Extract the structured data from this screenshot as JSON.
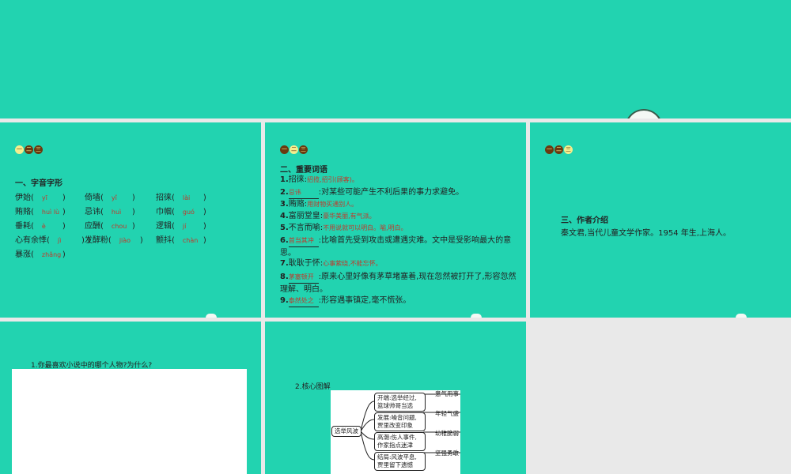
{
  "nav_dots": [
    "一",
    "二",
    "三"
  ],
  "slide2": {
    "heading": "一、字音字形",
    "rows": [
      [
        {
          "w": "伊始(",
          "p": "yī"
        },
        {
          "w": "倚墙(",
          "p": "yǐ"
        },
        {
          "w": "招徕(",
          "p": "lài"
        }
      ],
      [
        {
          "w": "贿赂(",
          "p": "huì lù"
        },
        {
          "w": "忌讳(",
          "p": "huì"
        },
        {
          "w": "巾帼(",
          "p": "guó"
        }
      ],
      [
        {
          "w": "垂耗(",
          "p": "è"
        },
        {
          "w": "应酬(",
          "p": "chou"
        },
        {
          "w": "逻辑(",
          "p": "jí"
        }
      ],
      [
        {
          "w": "心有余悸(",
          "p": "jì"
        },
        {
          "w": ")发酵粉(",
          "p": "jiào"
        },
        {
          "w": "颤抖(",
          "p": "chàn"
        }
      ],
      [
        {
          "w": "暴涨(",
          "p": "zhǎng"
        }
      ]
    ]
  },
  "slide3": {
    "heading": "二、重要词语",
    "items": [
      {
        "n": "1.",
        "term": "招徕",
        "ans": "招揽,招引(顾客)。",
        "def": ""
      },
      {
        "n": "2.",
        "term": "",
        "ans": "忌讳",
        "def": ":对某些可能产生不利后果的事力求避免。"
      },
      {
        "n": "3.",
        "term": "贿赂",
        "ans": "用财物买通别人。",
        "def": ""
      },
      {
        "n": "4.",
        "term": "富丽堂皇",
        "ans": "豪华美丽,有气派。",
        "def": ""
      },
      {
        "n": "5.",
        "term": "不言而喻",
        "ans": "不用说就可以明白。喻,明白。",
        "def": ""
      },
      {
        "n": "6.",
        "term": "",
        "ans": "首当其冲",
        "def": ":比喻首先受到攻击或遭遇灾难。文中是受影响最大的意思。"
      },
      {
        "n": "7.",
        "term": "耿耿于怀",
        "ans": "心事萦绕,不能忘怀。",
        "def": ""
      },
      {
        "n": "8.",
        "term": "",
        "ans": "茅塞顿开",
        "def": ":原来心里好像有茅草堵塞着,现在忽然被打开了,形容忽然理解、明白。"
      },
      {
        "n": "9.",
        "term": "",
        "ans": "泰然处之",
        "def": ":形容遇事镇定,毫不慌张。"
      }
    ]
  },
  "slide4": {
    "heading": "三、作者介绍",
    "text": "秦文君,当代儿童文学作家。1954 年生,上海人。"
  },
  "slide5": {
    "question": "1.你最喜欢小说中的哪个人物?为什么?"
  },
  "slide6": {
    "heading": "2.核心图解",
    "center": "选举风波",
    "branches": [
      {
        "text": "开端:选举经过,篮球帅哥当选",
        "tag": "意气用事"
      },
      {
        "text": "发展:噪音问题,贾里改变印象",
        "tag": "年轻气盛"
      },
      {
        "text": "高潮:伤人事件,作家指点迷津",
        "tag": "幼稚脆弱"
      },
      {
        "text": "结局:风波平息,贾里留下遗憾",
        "tag": "坚强勇敢"
      }
    ]
  }
}
